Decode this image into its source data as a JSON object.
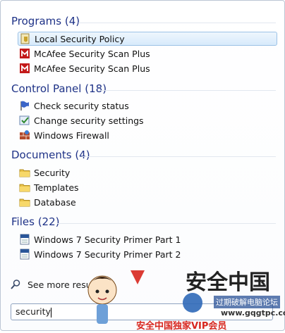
{
  "sections": {
    "programs": {
      "title": "Programs",
      "count": "(4)"
    },
    "control_panel": {
      "title": "Control Panel",
      "count": "(18)"
    },
    "documents": {
      "title": "Documents",
      "count": "(4)"
    },
    "files": {
      "title": "Files",
      "count": "(22)"
    }
  },
  "programs": [
    {
      "label": "Local Security Policy",
      "icon": "security-policy-icon"
    },
    {
      "label": "McAfee Security Scan Plus",
      "icon": "mcafee-icon"
    },
    {
      "label": "McAfee Security Scan Plus",
      "icon": "mcafee-icon"
    }
  ],
  "control_panel": [
    {
      "label": "Check security status",
      "icon": "flag-icon"
    },
    {
      "label": "Change security settings",
      "icon": "security-settings-icon"
    },
    {
      "label": "Windows Firewall",
      "icon": "firewall-icon"
    }
  ],
  "documents": [
    {
      "label": "Security",
      "icon": "folder-icon"
    },
    {
      "label": "Templates",
      "icon": "folder-icon"
    },
    {
      "label": "Database",
      "icon": "folder-icon"
    }
  ],
  "files": [
    {
      "label": "Windows 7 Security Primer Part 1",
      "icon": "word-document-icon"
    },
    {
      "label": "Windows 7 Security Primer Part 2",
      "icon": "word-document-icon"
    }
  ],
  "see_more": {
    "label": "See more results"
  },
  "search": {
    "value": "security"
  },
  "watermark": {
    "line1": "安全中国",
    "line2": "过期破解电脑论坛",
    "line3": "www.gqgtpc.com",
    "line4": "安全中国独家VIP会员"
  },
  "colors": {
    "section_title": "#1e3287",
    "selection_border": "#9cc2e6",
    "watermark_red": "#d7261e"
  }
}
